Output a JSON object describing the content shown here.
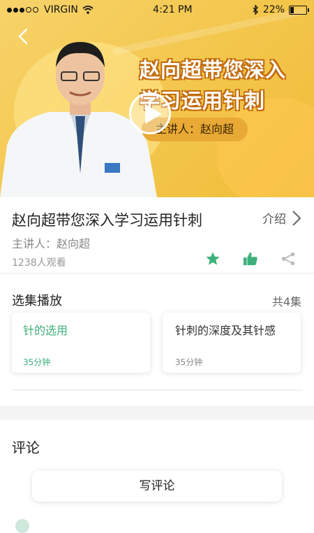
{
  "status_bar": {
    "carrier": "VIRGIN",
    "time": "4:21 PM",
    "battery": "22%",
    "battery_level": 0.22
  },
  "banner": {
    "title_line1": "赵向超带您深入",
    "title_line2": "学习运用针刺",
    "presenter_tag": "主讲人：赵向超"
  },
  "course": {
    "title": "赵向超带您深入学习运用针刺",
    "intro_label": "介绍",
    "presenter": "主讲人：赵向超",
    "views": "1238人观看"
  },
  "episodes": {
    "heading": "选集播放",
    "count": "共4集",
    "items": [
      {
        "title": "针的选用",
        "duration": "35分钟"
      },
      {
        "title": "针刺的深度及其针感",
        "duration": "35分钟"
      }
    ]
  },
  "comments": {
    "heading": "评论",
    "write_label": "写评论"
  },
  "colors": {
    "accent": "#3fb07c",
    "banner": "#f3c64b"
  },
  "icons": [
    "back-icon",
    "play-icon",
    "star-icon",
    "thumbs-up-icon",
    "share-icon",
    "chevron-right-icon",
    "wifi-icon",
    "bluetooth-icon"
  ]
}
